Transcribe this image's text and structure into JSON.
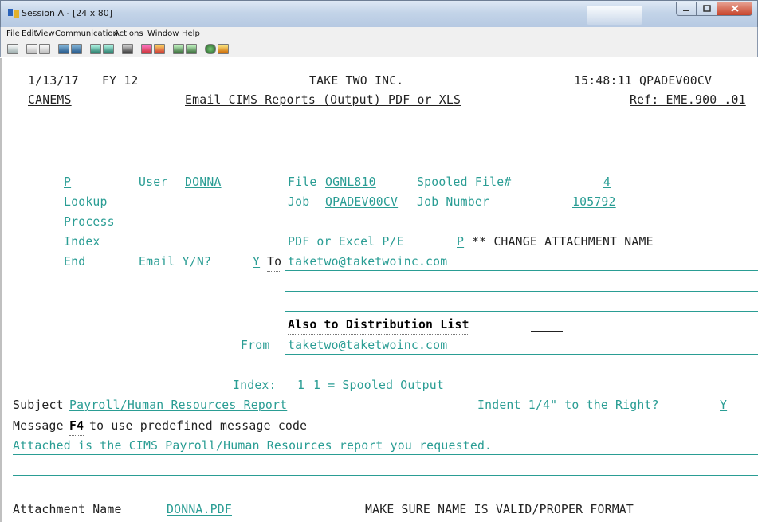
{
  "window": {
    "title": "Session A - [24 x 80]",
    "menu": [
      "File",
      "Edit",
      "View",
      "Communication",
      "Actions",
      "Window",
      "Help"
    ]
  },
  "terminal": {
    "date": "1/13/17",
    "fy": "FY 12",
    "company": "TAKE TWO INC.",
    "time_session": "15:48:11 QPADEV00CV",
    "program": "CANEMS",
    "screen_title": "Email CIMS Reports (Output) PDF or XLS",
    "ref": "Ref: EME.900 .01",
    "options": {
      "selected": "P",
      "items": [
        "Lookup",
        "Process",
        "Index",
        "End"
      ]
    },
    "user_label": "User",
    "user_value": "DONNA",
    "file_label": "File",
    "file_value": "OGNL810",
    "spooled_label": "Spooled File#",
    "spooled_value": "4",
    "job_label": "Job",
    "job_value": "QPADEV00CV",
    "job_number_label": "Job Number",
    "job_number_value": "105792",
    "pdf_excel_label": "PDF or Excel P/E",
    "pdf_excel_value": "P",
    "change_attachment_note": "** CHANGE ATTACHMENT NAME",
    "email_label": "Email Y/N?",
    "email_value": "Y",
    "to_label": "To",
    "to_value": "taketwo@taketwoinc.com",
    "distribution_label": "Also to Distribution List",
    "from_label": "From",
    "from_value": "taketwo@taketwoinc.com",
    "index_label": "Index:",
    "index_value": "1",
    "index_desc": "1 = Spooled Output",
    "subject_label": "Subject",
    "subject_value": "Payroll/Human Resources Report",
    "indent_label": "Indent 1/4\" to the Right?",
    "indent_value": "Y",
    "message_label": "Message",
    "f4_key": "F4",
    "message_hint": "to use predefined message code",
    "message_line1": "Attached is the CIMS Payroll/Human Resources report you requested.",
    "attachment_label": "Attachment Name",
    "attachment_value": "DONNA.PDF",
    "attachment_note": "MAKE SURE NAME IS VALID/PROPER FORMAT"
  },
  "colors": {
    "field_green": "#2a9d94",
    "text_dark": "#222222"
  }
}
